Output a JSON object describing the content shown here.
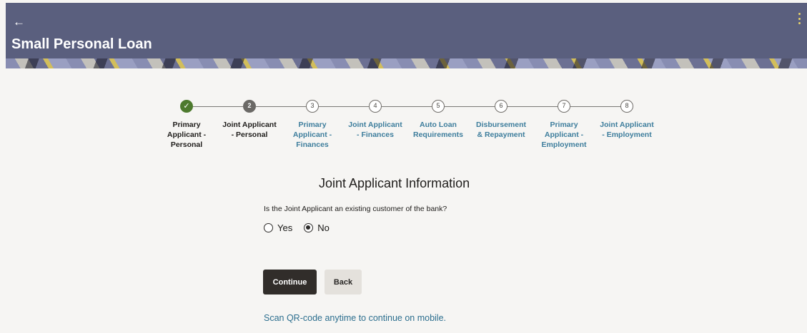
{
  "header": {
    "title": "Small Personal Loan",
    "back_icon": "left-arrow-icon",
    "menu_icon": "kebab-menu-icon",
    "background_color": "#5a5f7e"
  },
  "stepper": {
    "steps": [
      {
        "number": "✓",
        "status": "completed",
        "label": [
          "Primary",
          "Applicant -",
          "Personal"
        ]
      },
      {
        "number": "2",
        "status": "current",
        "label": [
          "Joint Applicant",
          "- Personal"
        ]
      },
      {
        "number": "3",
        "status": "upcoming",
        "label": [
          "Primary",
          "Applicant -",
          "Finances"
        ]
      },
      {
        "number": "4",
        "status": "upcoming",
        "label": [
          "Joint Applicant",
          "- Finances"
        ]
      },
      {
        "number": "5",
        "status": "upcoming",
        "label": [
          "Auto Loan",
          "Requirements"
        ]
      },
      {
        "number": "6",
        "status": "upcoming",
        "label": [
          "Disbursement",
          "& Repayment"
        ]
      },
      {
        "number": "7",
        "status": "upcoming",
        "label": [
          "Primary",
          "Applicant -",
          "Employment"
        ]
      },
      {
        "number": "8",
        "status": "upcoming",
        "label": [
          "Joint Applicant",
          "- Employment"
        ]
      }
    ]
  },
  "form": {
    "title": "Joint Applicant Information",
    "question": "Is the Joint Applicant an existing customer of the bank?",
    "options": [
      {
        "label": "Yes",
        "selected": false
      },
      {
        "label": "No",
        "selected": true
      }
    ]
  },
  "actions": {
    "continue_label": "Continue",
    "back_label": "Back"
  },
  "footer": {
    "qr_text": "Scan QR-code anytime to continue on mobile."
  }
}
